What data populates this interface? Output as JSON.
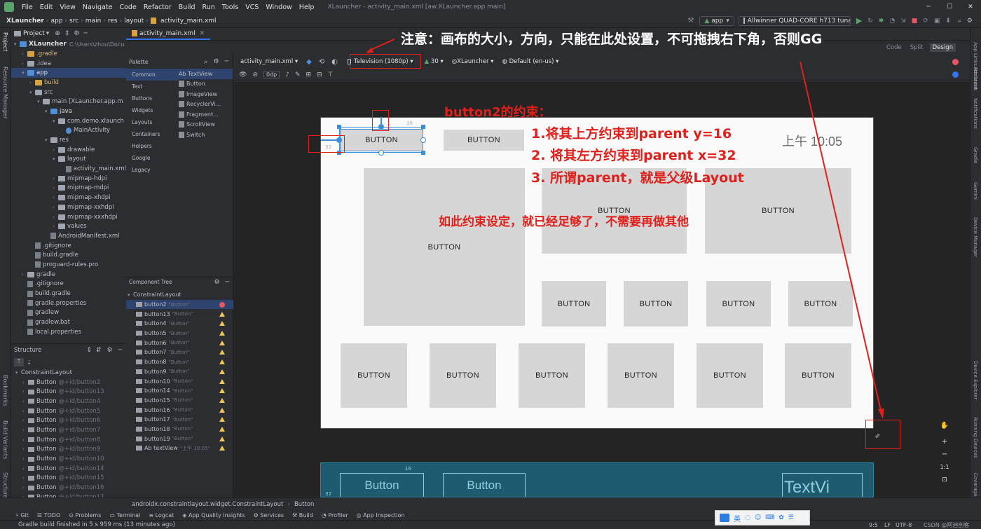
{
  "menubar": {
    "items": [
      "File",
      "Edit",
      "View",
      "Navigate",
      "Code",
      "Refactor",
      "Build",
      "Run",
      "Tools",
      "VCS",
      "Window",
      "Help"
    ],
    "title": "XLauncher - activity_main.xml [aw.XLauncher.app.main]"
  },
  "navbar": {
    "crumbs": [
      "XLauncher",
      "app",
      "src",
      "main",
      "res",
      "layout",
      "activity_main.xml"
    ],
    "run_config": "app",
    "device": "Allwinner QUAD-CORE h713 tuna ..."
  },
  "project": {
    "title": "Project",
    "tab": "activity_main.xml",
    "root": "XLauncher",
    "root_path": "C:\\Users\\zhou\\Docu",
    "rows": [
      {
        "indent": 1,
        "label": ".gradle",
        "type": "o"
      },
      {
        "indent": 1,
        "label": ".idea",
        "type": "f"
      },
      {
        "indent": 1,
        "label": "app",
        "type": "b",
        "sel": true
      },
      {
        "indent": 2,
        "label": "build",
        "type": "o"
      },
      {
        "indent": 2,
        "label": "src",
        "type": "f"
      },
      {
        "indent": 3,
        "label": "main [XLauncher.app.m",
        "type": "f"
      },
      {
        "indent": 4,
        "label": "java",
        "type": "b"
      },
      {
        "indent": 5,
        "label": "com.demo.xlaunch",
        "type": "f"
      },
      {
        "indent": 6,
        "label": "MainActivity",
        "type": "c"
      },
      {
        "indent": 4,
        "label": "res",
        "type": "f"
      },
      {
        "indent": 5,
        "label": "drawable",
        "type": "f"
      },
      {
        "indent": 5,
        "label": "layout",
        "type": "f"
      },
      {
        "indent": 6,
        "label": "activity_main.xml",
        "type": "x"
      },
      {
        "indent": 5,
        "label": "mipmap-hdpi",
        "type": "f"
      },
      {
        "indent": 5,
        "label": "mipmap-mdpi",
        "type": "f"
      },
      {
        "indent": 5,
        "label": "mipmap-xhdpi",
        "type": "f"
      },
      {
        "indent": 5,
        "label": "mipmap-xxhdpi",
        "type": "f"
      },
      {
        "indent": 5,
        "label": "mipmap-xxxhdpi",
        "type": "f"
      },
      {
        "indent": 5,
        "label": "values",
        "type": "f"
      },
      {
        "indent": 4,
        "label": "AndroidManifest.xml",
        "type": "x"
      },
      {
        "indent": 2,
        "label": ".gitignore",
        "type": "x"
      },
      {
        "indent": 2,
        "label": "build.gradle",
        "type": "x"
      },
      {
        "indent": 2,
        "label": "proguard-rules.pro",
        "type": "x"
      },
      {
        "indent": 1,
        "label": "gradle",
        "type": "f"
      },
      {
        "indent": 1,
        "label": ".gitignore",
        "type": "x"
      },
      {
        "indent": 1,
        "label": "build.gradle",
        "type": "x"
      },
      {
        "indent": 1,
        "label": "gradle.properties",
        "type": "x"
      },
      {
        "indent": 1,
        "label": "gradlew",
        "type": "x"
      },
      {
        "indent": 1,
        "label": "gradlew.bat",
        "type": "x"
      },
      {
        "indent": 1,
        "label": "local.properties",
        "type": "x"
      }
    ]
  },
  "structure": {
    "title": "Structure",
    "root": "ConstraintLayout",
    "items": [
      "@+id/button2",
      "@+id/button13",
      "@+id/button4",
      "@+id/button5",
      "@+id/button6",
      "@+id/button7",
      "@+id/button8",
      "@+id/button9",
      "@+id/button10",
      "@+id/button14",
      "@+id/button15",
      "@+id/button16",
      "@+id/button17"
    ],
    "item_kind": "Button"
  },
  "palette": {
    "title": "Palette",
    "categories": [
      "Common",
      "Text",
      "Buttons",
      "Widgets",
      "Layouts",
      "Containers",
      "Helpers",
      "Google",
      "Legacy"
    ],
    "widgets": [
      "Ab TextView",
      "Button",
      "ImageView",
      "RecyclerVi...",
      "Fragment...",
      "ScrollView",
      "Switch"
    ]
  },
  "component_tree": {
    "title": "Component Tree",
    "root": "ConstraintLayout",
    "items": [
      {
        "name": "button2",
        "text": "\"Button\"",
        "status": "err",
        "sel": true
      },
      {
        "name": "button13",
        "text": "\"Button\"",
        "status": "warn"
      },
      {
        "name": "button4",
        "text": "\"Button\"",
        "status": "warn"
      },
      {
        "name": "button5",
        "text": "\"Button\"",
        "status": "warn"
      },
      {
        "name": "button6",
        "text": "\"Button\"",
        "status": "warn"
      },
      {
        "name": "button7",
        "text": "\"Button\"",
        "status": "warn"
      },
      {
        "name": "button8",
        "text": "\"Button\"",
        "status": "warn"
      },
      {
        "name": "button9",
        "text": "\"Button\"",
        "status": "warn"
      },
      {
        "name": "button10",
        "text": "\"Button\"",
        "status": "warn"
      },
      {
        "name": "button14",
        "text": "\"Button\"",
        "status": "warn"
      },
      {
        "name": "button15",
        "text": "\"Button\"",
        "status": "warn"
      },
      {
        "name": "button16",
        "text": "\"Button\"",
        "status": "warn"
      },
      {
        "name": "button17",
        "text": "\"Button\"",
        "status": "warn"
      },
      {
        "name": "button18",
        "text": "\"Button\"",
        "status": "warn"
      },
      {
        "name": "button19",
        "text": "\"Button\"",
        "status": "warn"
      },
      {
        "name": "Ab textView",
        "text": "\"上午 10:05\"",
        "status": "warn"
      }
    ]
  },
  "design_toolbar": {
    "file": "activity_main.xml",
    "device": "Television (1080p)",
    "api": "30",
    "theme": "XLauncher",
    "locale": "Default (en-us)",
    "margin": "0dp"
  },
  "view_modes": [
    "Code",
    "Split",
    "Design"
  ],
  "device_preview": {
    "button_label": "BUTTON",
    "time": "上午 10:05",
    "margin_top": "16",
    "margin_left": "32"
  },
  "blueprint": {
    "button1": "Button",
    "button2": "Button",
    "textview": "TextVi",
    "margin_top": "16",
    "margin_left": "32"
  },
  "annotations": {
    "top_note": "注意：画布的大小，方向，只能在此处设置，不可拖拽右下角，否则GG",
    "title": "button2的约束：",
    "rules": [
      "1.将其上方约束到parent y=16",
      "2. 将其左方约束到parent x=32",
      "3. 所谓parent，就是父级Layout"
    ],
    "summary": "如此约束设定，就已经足够了，不需要再做其他"
  },
  "statusbar": {
    "path": [
      "androidx.constraintlayout.widget.ConstraintLayout",
      "Button"
    ]
  },
  "toolwindows": [
    "Git",
    "TODO",
    "Problems",
    "Terminal",
    "Logcat",
    "App Quality Insights",
    "Services",
    "Build",
    "Profiler",
    "App Inspection"
  ],
  "bottom": {
    "message": "Gradle build finished in 5 s 959 ms (13 minutes ago)",
    "position": "9:5",
    "line_sep": "LF",
    "encoding": "UTF-8",
    "watermark": "CSDN @阿迪创客"
  },
  "ime": [
    "英"
  ],
  "left_strip": [
    "Project",
    "Resource Manager",
    "Bookmarks",
    "Build Variants",
    "Structure"
  ],
  "right_strip": [
    "App Links Assistant",
    "Attributes",
    "Notifications",
    "Gradle",
    "Gemini",
    "Device Manager",
    "Device Explorer",
    "Running Devices",
    "Coverage"
  ],
  "colors": {
    "annotation": "#e0201b",
    "selection": "#2e436e",
    "blueprint": "#1f5a6e"
  }
}
